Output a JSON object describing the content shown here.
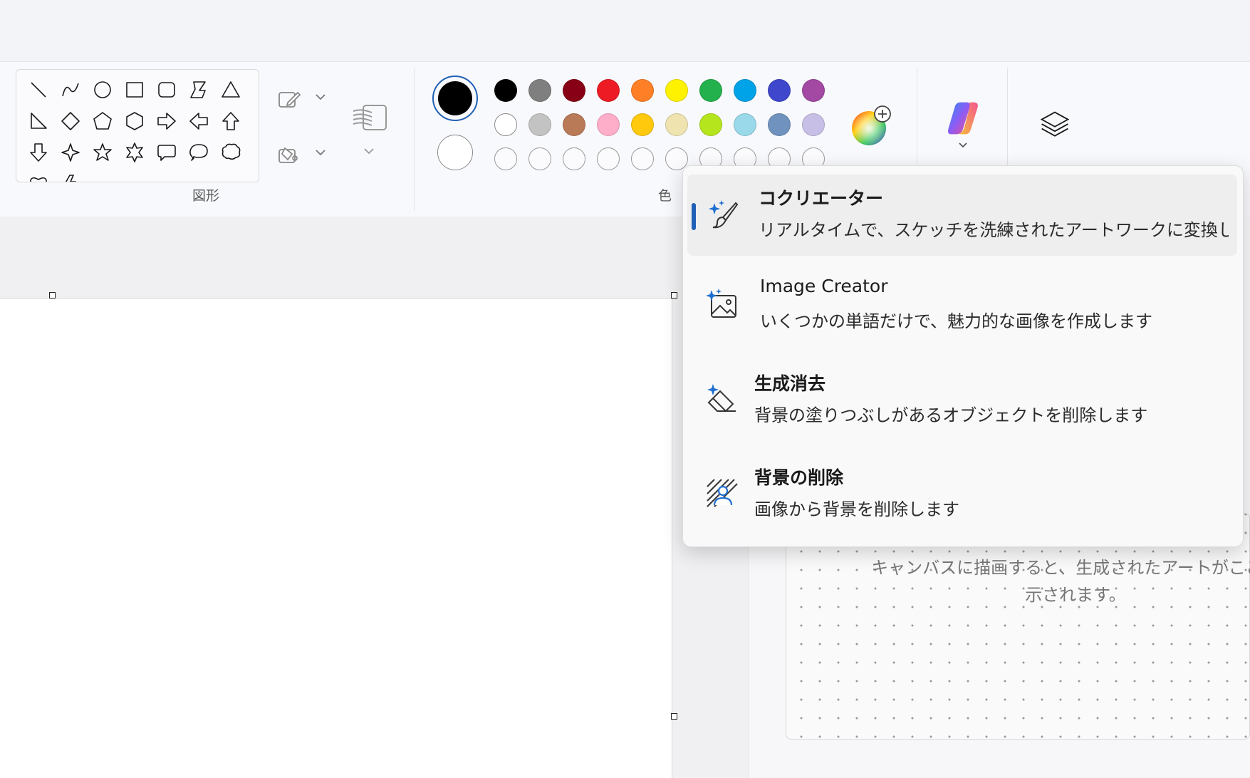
{
  "ribbon": {
    "shapes_label": "図形",
    "colors_label": "色",
    "shape_icons": [
      "line-icon",
      "curve-icon",
      "oval-icon",
      "rectangle-icon",
      "rounded-rectangle-icon",
      "polygon-icon",
      "triangle-icon",
      "right-triangle-icon",
      "diamond-icon",
      "pentagon-icon",
      "hexagon-icon",
      "right-arrow-icon",
      "left-arrow-icon",
      "up-arrow-icon",
      "down-arrow-icon",
      "four-point-star-icon",
      "five-point-star-icon",
      "six-point-star-icon",
      "rounded-callout-icon",
      "oval-callout-icon",
      "cloud-callout-icon",
      "heart-icon",
      "lightning-icon"
    ],
    "primary_color": "#000000",
    "secondary_color": "#ffffff",
    "palette_row1": [
      "#000000",
      "#7f7f7f",
      "#880015",
      "#ed1c24",
      "#ff7f27",
      "#fff200",
      "#22b14c",
      "#00a2e8",
      "#3f48cc",
      "#a349a4"
    ],
    "palette_row2": [
      "#ffffff",
      "#c3c3c3",
      "#b97a57",
      "#ffaec9",
      "#ffc90e",
      "#efe4b0",
      "#b5e61d",
      "#99d9ea",
      "#7092be",
      "#c8bfe7"
    ],
    "palette_row3": [
      "",
      "",
      "",
      "",
      "",
      "",
      "",
      "",
      "",
      ""
    ]
  },
  "flyout": {
    "items": [
      {
        "title": "コクリエーター",
        "desc": "リアルタイムで、スケッチを洗練されたアートワークに変換し...",
        "icon": "cocreator-brush-icon",
        "selected": true
      },
      {
        "title": "Image Creator",
        "desc": "いくつかの単語だけで、魅力的な画像を作成します",
        "icon": "image-creator-icon",
        "selected": false
      },
      {
        "title": "生成消去",
        "desc": "背景の塗りつぶしがあるオブジェクトを削除します",
        "icon": "generative-erase-icon",
        "selected": false
      },
      {
        "title": "背景の削除",
        "desc": "画像から背景を削除します",
        "icon": "remove-background-icon",
        "selected": false
      }
    ]
  },
  "cocreator_panel": {
    "hint_line1": "キャンバスに描画すると、生成されたアートがここに",
    "hint_line2": "示されます。"
  },
  "colors": {
    "accent": "#1f5fb5",
    "copilot_gradient": [
      "#2f8cf0",
      "#f24f8a",
      "#f7b731"
    ]
  }
}
